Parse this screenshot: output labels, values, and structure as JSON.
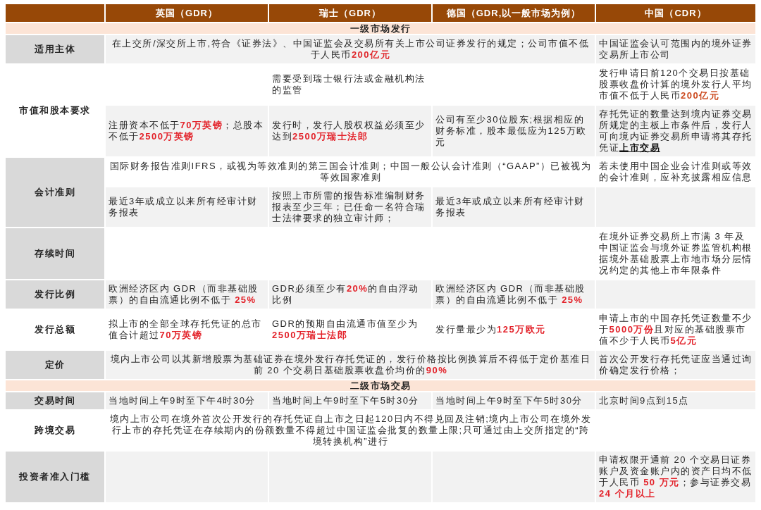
{
  "table": {
    "columns": [
      "英国（GDR）",
      "瑞士（GDR）",
      "德国（GDR,以一般市场为例）",
      "中国（CDR）"
    ],
    "sections": [
      {
        "title": "一级市场发行",
        "groups": [
          {
            "label": "适用主体",
            "shaded": true,
            "lines": [
              {
                "shaded": true,
                "cells": [
                  {
                    "kind": "wide",
                    "runs": [
                      {
                        "kind": "plain",
                        "text": "在上交所/深交所上市,符合《证券法》、中国证监会及交易所有关上市公司证券发行的规定；公司市值不低于人民币"
                      },
                      {
                        "kind": "highlight",
                        "color": "#e0282c",
                        "text": "200亿元"
                      }
                    ]
                  },
                  {
                    "kind": "single",
                    "text": "中国证监会认可范围内的境外证券交易所上市公司"
                  }
                ]
              }
            ]
          },
          {
            "label": "市值和股本要求",
            "shaded": false,
            "lines": [
              {
                "shaded": false,
                "cells": [
                  {
                    "kind": "blank"
                  },
                  {
                    "kind": "single",
                    "text": "需要受到瑞士银行法或金融机构法的监管"
                  },
                  {
                    "kind": "blank"
                  },
                  {
                    "kind": "single",
                    "runs": [
                      {
                        "kind": "plain",
                        "text": "发行申请日前120个交易日按基础股票收盘价计算的境外发行人平均市值不低于人民币"
                      },
                      {
                        "kind": "highlight",
                        "color": "#cc4a1f",
                        "text": "200亿元"
                      }
                    ]
                  }
                ]
              },
              {
                "shaded": true,
                "cells": [
                  {
                    "kind": "single",
                    "runs": [
                      {
                        "kind": "plain",
                        "text": "注册资本不低于"
                      },
                      {
                        "kind": "highlight",
                        "color": "#e3222a",
                        "text": "70万英镑"
                      },
                      {
                        "kind": "plain",
                        "text": "；总股本不低于"
                      },
                      {
                        "kind": "highlight",
                        "color": "#e3222a",
                        "text": "2500万英镑"
                      }
                    ]
                  },
                  {
                    "kind": "single",
                    "runs": [
                      {
                        "kind": "plain",
                        "text": "发行时，发行人股权权益必须至少达到"
                      },
                      {
                        "kind": "highlight",
                        "color": "#e3222a",
                        "text": "2500万瑞士法郎"
                      }
                    ]
                  },
                  {
                    "kind": "single",
                    "text": "公司有至少30位股东;根据相应的财务标准，股本最低应为125万欧元"
                  },
                  {
                    "kind": "single",
                    "runs": [
                      {
                        "kind": "plain",
                        "text": "存托凭证的数量达到境内证券交易所规定的主板上市条件后，发行人可向境内证券交易所申请将其存托凭证"
                      },
                      {
                        "kind": "underlined",
                        "text": "上市交易"
                      }
                    ]
                  }
                ]
              }
            ]
          },
          {
            "label": "会计准则",
            "shaded": true,
            "lines": [
              {
                "shaded": false,
                "cells": [
                  {
                    "kind": "wide",
                    "text": "国际财务报告准则IFRS，或视为等效准则的第三国会计准则；中国一般公认会计准则（“GAAP”）已被视为等效国家准则"
                  },
                  {
                    "kind": "single",
                    "text": "若未使用中国企业会计准则或等效的会计准则，应补充披露相应信息"
                  }
                ]
              },
              {
                "shaded": true,
                "cells": [
                  {
                    "kind": "single",
                    "text": "最近3年或成立以来所有经审计财务报表"
                  },
                  {
                    "kind": "single",
                    "text": "按照上市所需的报告标准编制财务报表至少三年；已任命一名符合瑞士法律要求的独立审计师；"
                  },
                  {
                    "kind": "single",
                    "text": "最近3年或成立以来所有经审计财务报表"
                  },
                  {
                    "kind": "blank"
                  }
                ]
              }
            ]
          },
          {
            "label": "存续时间",
            "shaded": true,
            "lines": [
              {
                "shaded": false,
                "cells": [
                  {
                    "kind": "blank"
                  },
                  {
                    "kind": "blank"
                  },
                  {
                    "kind": "blank"
                  },
                  {
                    "kind": "single",
                    "text": "在境外证券交易所上市满 3 年及中国证监会与境外证券监管机构根据境外基础股票上市地市场分层情况约定的其他上市年限条件"
                  }
                ]
              }
            ]
          },
          {
            "label": "发行比例",
            "shaded": true,
            "lines": [
              {
                "shaded": true,
                "cells": [
                  {
                    "kind": "single",
                    "runs": [
                      {
                        "kind": "plain",
                        "text": "欧洲经济区内 GDR（而非基础股票）的自由流通比例不低于 "
                      },
                      {
                        "kind": "highlight",
                        "color": "#e3222a",
                        "text": "25%"
                      }
                    ]
                  },
                  {
                    "kind": "single",
                    "runs": [
                      {
                        "kind": "plain",
                        "text": "GDR必须至少有"
                      },
                      {
                        "kind": "highlight",
                        "color": "#e3222a",
                        "text": "20%"
                      },
                      {
                        "kind": "plain",
                        "text": "的自由浮动比例"
                      }
                    ]
                  },
                  {
                    "kind": "single",
                    "runs": [
                      {
                        "kind": "plain",
                        "text": "欧洲经济区内 GDR（而非基础股票）的自由流通比例不低于 "
                      },
                      {
                        "kind": "highlight",
                        "color": "#e3222a",
                        "text": "25%"
                      }
                    ]
                  },
                  {
                    "kind": "blank"
                  }
                ]
              }
            ]
          },
          {
            "label": "发行总额",
            "shaded": false,
            "lines": [
              {
                "shaded": false,
                "cells": [
                  {
                    "kind": "single",
                    "runs": [
                      {
                        "kind": "plain",
                        "text": "拟上市的全部全球存托凭证的总市值合计超过"
                      },
                      {
                        "kind": "highlight",
                        "color": "#e3222a",
                        "text": "70万英镑"
                      }
                    ]
                  },
                  {
                    "kind": "single",
                    "runs": [
                      {
                        "kind": "plain",
                        "text": "GDR的预期自由流通市值至少为"
                      },
                      {
                        "kind": "highlight",
                        "color": "#e3222a",
                        "text": "2500万瑞士法郎"
                      }
                    ]
                  },
                  {
                    "kind": "single",
                    "runs": [
                      {
                        "kind": "plain",
                        "text": "发行量最少为"
                      },
                      {
                        "kind": "highlight",
                        "color": "#e3222a",
                        "text": "125万欧元"
                      }
                    ]
                  },
                  {
                    "kind": "single",
                    "runs": [
                      {
                        "kind": "plain",
                        "text": "申请上市的中国存托凭证数量不少于"
                      },
                      {
                        "kind": "highlight",
                        "color": "#e3222a",
                        "text": "5000万份"
                      },
                      {
                        "kind": "plain",
                        "text": "且对应的基础股票市值不少于人民币"
                      },
                      {
                        "kind": "highlight",
                        "color": "#e3222a",
                        "text": "5亿元"
                      }
                    ]
                  }
                ]
              }
            ]
          },
          {
            "label": "定价",
            "shaded": true,
            "lines": [
              {
                "shaded": true,
                "cells": [
                  {
                    "kind": "wide",
                    "runs": [
                      {
                        "kind": "plain",
                        "text": "境内上市公司以其新增股票为基础证券在境外发行存托凭证的，发行价格按比例换算后不得低于定价基准日前 20 个交易日基础股票收盘价均价的"
                      },
                      {
                        "kind": "highlight",
                        "color": "#e3222a",
                        "text": "90%"
                      }
                    ]
                  },
                  {
                    "kind": "single",
                    "text": "首次公开发行存托凭证应当通过询价确定发行价格；"
                  }
                ]
              }
            ]
          }
        ]
      },
      {
        "title": "二级市场交易",
        "groups": [
          {
            "label": "交易时间",
            "shaded": true,
            "lines": [
              {
                "shaded": true,
                "cells": [
                  {
                    "kind": "single",
                    "text": "当地时间上午9时至下午4时30分"
                  },
                  {
                    "kind": "single",
                    "text": "当地时间上午9时至下午5时30分"
                  },
                  {
                    "kind": "single",
                    "text": "当地时间上午9时至下午5时30分"
                  },
                  {
                    "kind": "single",
                    "text": "北京时间9点到15点"
                  }
                ]
              }
            ]
          },
          {
            "label": "跨境交易",
            "shaded": false,
            "lines": [
              {
                "shaded": false,
                "cells": [
                  {
                    "kind": "wide",
                    "text": "境内上市公司在境外首次公开发行的存托凭证自上市之日起120日内不得兑回及注销;境内上市公司在境外发行上市的存托凭证在存续期内的份额数量不得超过中国证监会批复的数量上限;只可通过由上交所指定的“跨境转换机构”进行"
                  },
                  {
                    "kind": "blank"
                  }
                ]
              }
            ]
          },
          {
            "label": "投资者准入门槛",
            "shaded": true,
            "lines": [
              {
                "shaded": true,
                "cells": [
                  {
                    "kind": "blank"
                  },
                  {
                    "kind": "blank"
                  },
                  {
                    "kind": "blank"
                  },
                  {
                    "kind": "single",
                    "runs": [
                      {
                        "kind": "plain",
                        "text": "申请权限开通前 20 个交易日证券账户及资金账户内的资产日均不低于人民币 "
                      },
                      {
                        "kind": "highlight",
                        "color": "#e3222a",
                        "text": "50 万元"
                      },
                      {
                        "kind": "plain",
                        "text": "；参与证券交易 "
                      },
                      {
                        "kind": "highlight",
                        "color": "#e3222a",
                        "text": "24 个月以上"
                      }
                    ]
                  }
                ]
              }
            ]
          }
        ]
      }
    ]
  }
}
